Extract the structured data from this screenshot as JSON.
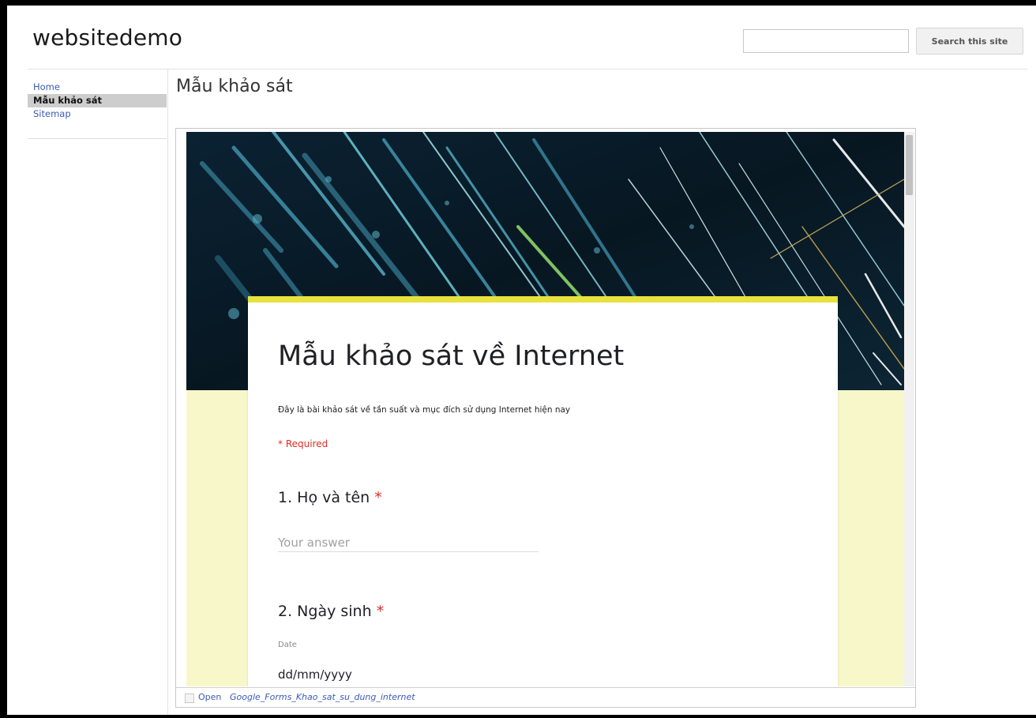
{
  "site": {
    "title": "websitedemo",
    "search_placeholder": "",
    "search_button": "Search this site"
  },
  "sidebar": {
    "items": [
      {
        "label": "Home",
        "active": false
      },
      {
        "label": "Mẫu khảo sát",
        "active": true
      },
      {
        "label": "Sitemap",
        "active": false
      }
    ]
  },
  "page": {
    "title": "Mẫu khảo sát"
  },
  "form": {
    "title": "Mẫu khảo sát về Internet",
    "description": "Đây là bài khảo sát về tần suất và mục đích sử dụng Internet hiện nay",
    "required_note": "* Required",
    "required_marker": "*",
    "questions": [
      {
        "label": "1. Họ và tên",
        "placeholder": "Your answer"
      },
      {
        "label": "2. Ngày sinh",
        "caption": "Date",
        "placeholder": "dd/mm/yyyy"
      }
    ],
    "accent_color": "#e8e23f",
    "background_color": "#f8f7c9"
  },
  "embed_footer": {
    "open_label": "Open",
    "file_name": "Google_Forms_Khao_sat_su_dung_internet"
  }
}
